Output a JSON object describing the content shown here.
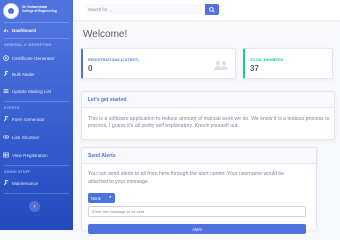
{
  "brand": {
    "line1": "Sir Vishweshwar",
    "line2": "College of Engineering"
  },
  "sidebar": {
    "dashboard": "Dashboard",
    "heading_general": "GENERAL & MARKETING",
    "certificate": "Certificate Generator",
    "bulk_mailer": "Bulk Mailer",
    "mailing_list": "Update Mailing List",
    "heading_events": "EVENTS",
    "form_generator": "Form Generator",
    "link_shortner": "Link Shortner",
    "view_registration": "View Registration",
    "heading_admin": "ADMIN STUFF",
    "maintenance": "Maintenance",
    "collapse_glyph": "‹"
  },
  "search": {
    "placeholder": "Search for ..."
  },
  "page_title": "Welcome!",
  "stats": {
    "registrations_label": "REGISTRATIONS (LATEST)",
    "registrations_value": "0",
    "members_label": "TOTAL MEMBERS",
    "members_value": "37"
  },
  "get_started": {
    "title": "Let's get started",
    "text_line1": "This is a software application to reduce amount of manual work we do. We know it is a tedious process to",
    "text_line2": "process. I guess it's all pretty self explanatory. Knock yourself out."
  },
  "alerts": {
    "title": "Send Alerts",
    "text_line1": "You can send alerts to all from here through the alert center. Your username would be",
    "text_line2": "attached to your message.",
    "select_value": "None",
    "input_placeholder": "Enter the message to be sent",
    "button_label": "Alert!"
  },
  "colors": {
    "primary": "#4e73df",
    "success": "#1cc88a",
    "text": "#858796"
  },
  "icons": {
    "search": "search-icon",
    "users": "users-icon",
    "collapse": "chevron-left-icon"
  }
}
